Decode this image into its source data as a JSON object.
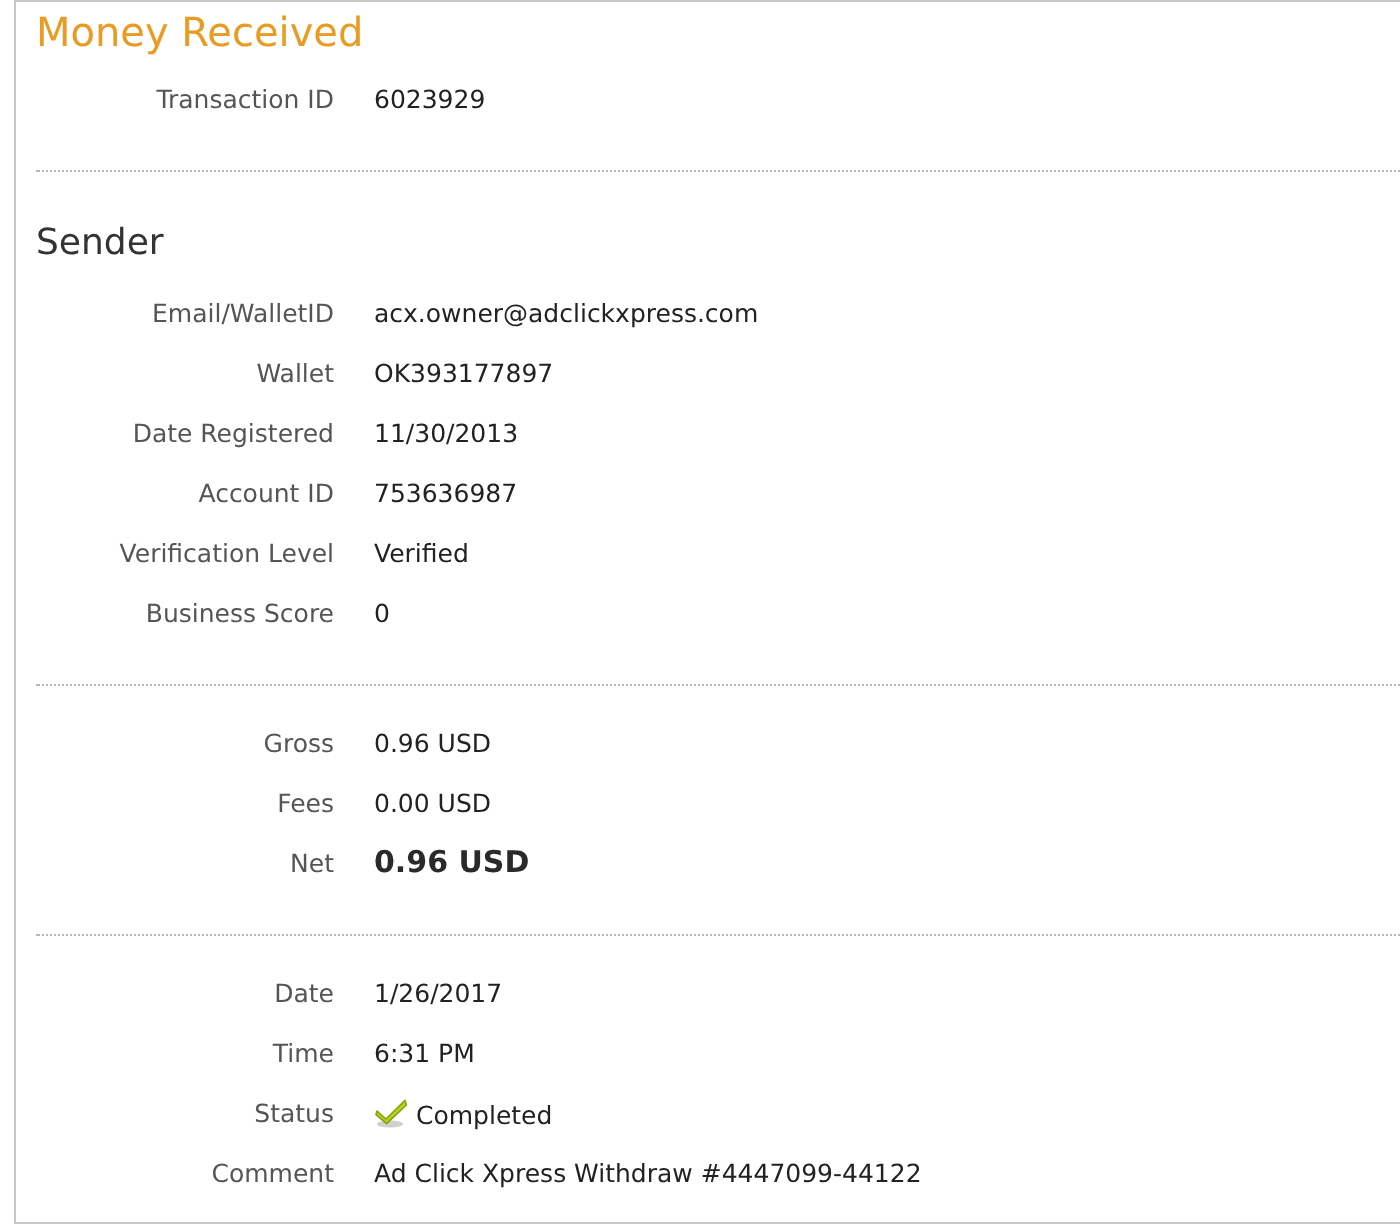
{
  "title": "Money Received",
  "sections": [
    {
      "rows": [
        {
          "kind": "text",
          "label": "Transaction ID",
          "value": "6023929"
        }
      ]
    },
    {
      "heading": "Sender",
      "rows": [
        {
          "kind": "text",
          "label": "Email/WalletID",
          "value": "acx.owner@adclickxpress.com"
        },
        {
          "kind": "text",
          "label": "Wallet",
          "value": "OK393177897"
        },
        {
          "kind": "text",
          "label": "Date Registered",
          "value": "11/30/2013"
        },
        {
          "kind": "text",
          "label": "Account ID",
          "value": "753636987"
        },
        {
          "kind": "text",
          "label": "Verification Level",
          "value": "Verified"
        },
        {
          "kind": "text",
          "label": "Business Score",
          "value": "0"
        }
      ]
    },
    {
      "rows": [
        {
          "kind": "text",
          "label": "Gross",
          "value": "0.96 USD"
        },
        {
          "kind": "text",
          "label": "Fees",
          "value": "0.00 USD"
        },
        {
          "kind": "total",
          "label": "Net",
          "value": "0.96 USD"
        }
      ]
    },
    {
      "rows": [
        {
          "kind": "text",
          "label": "Date",
          "value": "1/26/2017"
        },
        {
          "kind": "text",
          "label": "Time",
          "value": "6:31 PM"
        },
        {
          "kind": "status",
          "label": "Status",
          "value": "Completed"
        },
        {
          "kind": "text",
          "label": "Comment",
          "value": "Ad Click Xpress Withdraw #4447099-44122"
        }
      ]
    }
  ]
}
